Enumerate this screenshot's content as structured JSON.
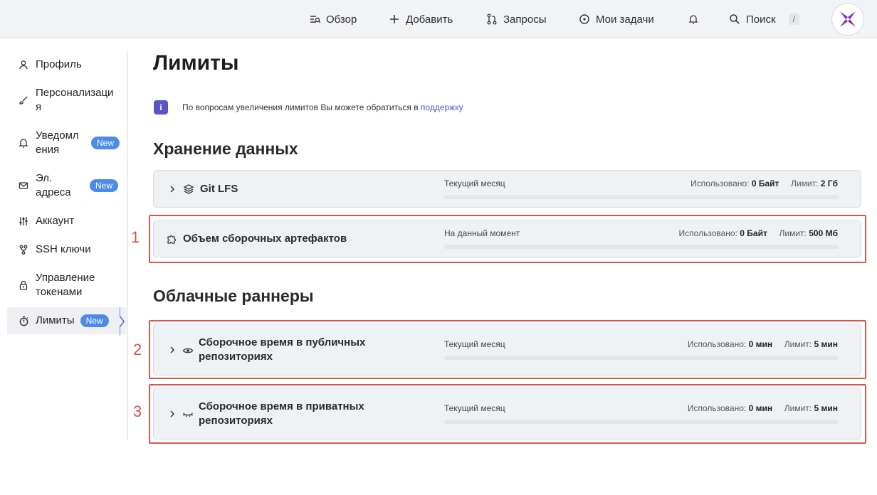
{
  "topnav": {
    "overview": "Обзор",
    "add": "Добавить",
    "requests": "Запросы",
    "tasks": "Мои задачи",
    "search": "Поиск",
    "search_shortcut": "/"
  },
  "sidebar": {
    "items": [
      {
        "label": "Профиль",
        "icon": "user-icon"
      },
      {
        "label": "Персонализация",
        "icon": "brush-icon"
      },
      {
        "label": "Уведомления",
        "icon": "bell-icon",
        "badge": "New"
      },
      {
        "label": "Эл. адреса",
        "icon": "mail-icon",
        "badge": "New"
      },
      {
        "label": "Аккаунт",
        "icon": "sliders-icon"
      },
      {
        "label": "SSH ключи",
        "icon": "key-icon"
      },
      {
        "label": "Управление токенами",
        "icon": "lock-icon"
      },
      {
        "label": "Лимиты",
        "icon": "stopwatch-icon",
        "badge": "New",
        "active": true
      }
    ],
    "line_breaks": [
      "Профиль",
      "Персонализаци|я",
      "Уведомл|ения",
      "Эл.|адреса",
      "Аккаунт",
      "SSH ключи",
      "Управление|токенами",
      "Лимиты"
    ]
  },
  "page": {
    "title": "Лимиты",
    "info_text": "По вопросам увеличения лимитов Вы можете обратиться в ",
    "info_link": "поддержку"
  },
  "storage": {
    "heading": "Хранение данных",
    "cards": [
      {
        "title": "Git LFS",
        "period": "Текущий месяц",
        "used_label": "Использовано:",
        "used": "0 Байт",
        "limit_label": "Лимит:",
        "limit": "2 Гб",
        "usage_fraction": 0
      },
      {
        "title": "Объем сборочных артефактов",
        "period": "На данный момент",
        "used_label": "Использовано:",
        "used": "0 Байт",
        "limit_label": "Лимит:",
        "limit": "500 Мб",
        "usage_fraction": 0
      }
    ]
  },
  "runners": {
    "heading": "Облачные раннеры",
    "cards": [
      {
        "title_line1": "Сборочное время в публичных",
        "title_line2": "репозиториях",
        "period": "Текущий месяц",
        "used_label": "Использовано:",
        "used": "0 мин",
        "limit_label": "Лимит:",
        "limit": "5 мин",
        "usage_fraction": 0
      },
      {
        "title_line1": "Сборочное время в приватных",
        "title_line2": "репозиториях",
        "period": "Текущий месяц",
        "used_label": "Использовано:",
        "used": "0 мин",
        "limit_label": "Лимит:",
        "limit": "5 мин",
        "usage_fraction": 0
      }
    ]
  },
  "annotations": [
    "1",
    "2",
    "3"
  ],
  "colors": {
    "accent": "#5b54c7",
    "badge": "#4c8be8",
    "highlight": "#d9534f"
  }
}
